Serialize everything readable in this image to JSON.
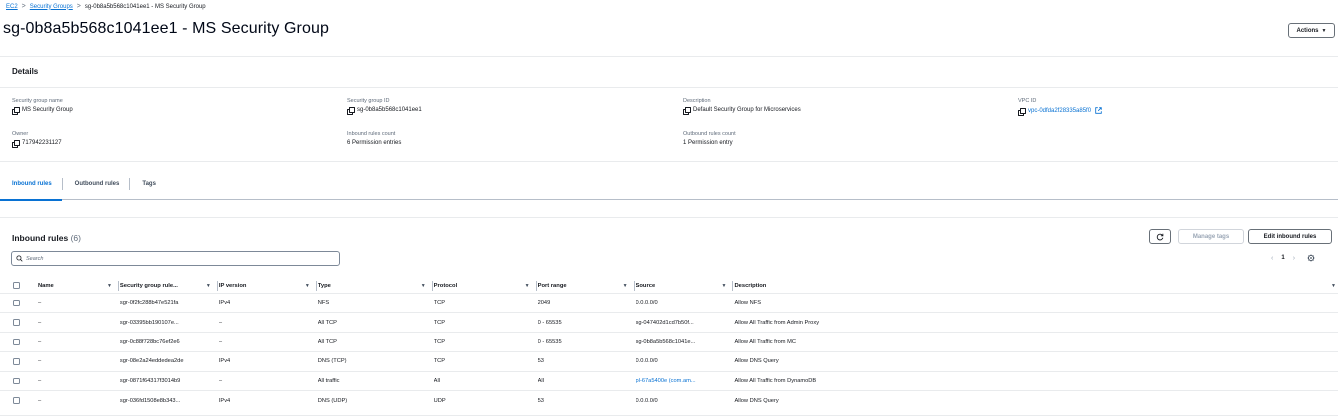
{
  "breadcrumb": {
    "items": [
      "EC2",
      "Security Groups",
      "sg-0b8a5b568c1041ee1 - MS Security Group"
    ],
    "separator": ">"
  },
  "page": {
    "title": "sg-0b8a5b568c1041ee1 - MS Security Group",
    "actions_label": "Actions"
  },
  "details": {
    "header": "Details",
    "fields": {
      "sg_name": {
        "label": "Security group name",
        "value": "MS Security Group"
      },
      "sg_id": {
        "label": "Security group ID",
        "value": "sg-0b8a5b568c1041ee1"
      },
      "description": {
        "label": "Description",
        "value": "Default Security Group for Microservices"
      },
      "vpc_id": {
        "label": "VPC ID",
        "value": "vpc-0dfda2f28335a85f0"
      },
      "owner": {
        "label": "Owner",
        "value": "717942231127"
      },
      "inbound_count": {
        "label": "Inbound rules count",
        "value": "6 Permission entries"
      },
      "outbound_count": {
        "label": "Outbound rules count",
        "value": "1 Permission entry"
      }
    }
  },
  "tabs": [
    {
      "label": "Inbound rules",
      "active": true
    },
    {
      "label": "Outbound rules",
      "active": false
    },
    {
      "label": "Tags",
      "active": false
    }
  ],
  "inbound": {
    "title": "Inbound rules",
    "count": "(6)",
    "manage_tags_label": "Manage tags",
    "edit_label": "Edit inbound rules",
    "search_placeholder": "Search",
    "page_number": "1",
    "columns": [
      "Name",
      "Security group rule...",
      "IP version",
      "Type",
      "Protocol",
      "Port range",
      "Source",
      "Description"
    ],
    "rows": [
      {
        "name": "–",
        "rule_id": "sgr-0f2fc288b47e521fa",
        "ip_version": "IPv4",
        "type": "NFS",
        "protocol": "TCP",
        "port_range": "2049",
        "source": "0.0.0.0/0",
        "source_is_link": false,
        "description": "Allow NFS"
      },
      {
        "name": "–",
        "rule_id": "sgr-03395bb190107e...",
        "ip_version": "–",
        "type": "All TCP",
        "protocol": "TCP",
        "port_range": "0 - 65535",
        "source": "sg-047402d1cd7b50f...",
        "source_is_link": false,
        "description": "Allow All Traffic from Admin Proxy"
      },
      {
        "name": "–",
        "rule_id": "sgr-0c88f728bc76ef2e6",
        "ip_version": "–",
        "type": "All TCP",
        "protocol": "TCP",
        "port_range": "0 - 65535",
        "source": "sg-0b8a5b568c1041e...",
        "source_is_link": false,
        "description": "Allow All Traffic from MC"
      },
      {
        "name": "–",
        "rule_id": "sgr-08e2a24eddedea2de",
        "ip_version": "IPv4",
        "type": "DNS (TCP)",
        "protocol": "TCP",
        "port_range": "53",
        "source": "0.0.0.0/0",
        "source_is_link": false,
        "description": "Allow DNS Query"
      },
      {
        "name": "–",
        "rule_id": "sgr-0871f64317f3014b9",
        "ip_version": "–",
        "type": "All traffic",
        "protocol": "All",
        "port_range": "All",
        "source": "pl-67a5400e (com.am...",
        "source_is_link": true,
        "description": "Allow All Traffic from DynamoDB"
      },
      {
        "name": "–",
        "rule_id": "sgr-036fd1508e8b343...",
        "ip_version": "IPv4",
        "type": "DNS (UDP)",
        "protocol": "UDP",
        "port_range": "53",
        "source": "0.0.0.0/0",
        "source_is_link": false,
        "description": "Allow DNS Query"
      }
    ]
  },
  "colors": {
    "link": "#0972d3",
    "text": "#16191f",
    "muted": "#5f6b7a",
    "border": "#e9ebed"
  },
  "icons": [
    "copy-icon",
    "external-link-icon",
    "search-icon",
    "refresh-icon",
    "caret-down-icon",
    "sort-icon",
    "chevron-left-icon",
    "chevron-right-icon",
    "settings-icon"
  ]
}
